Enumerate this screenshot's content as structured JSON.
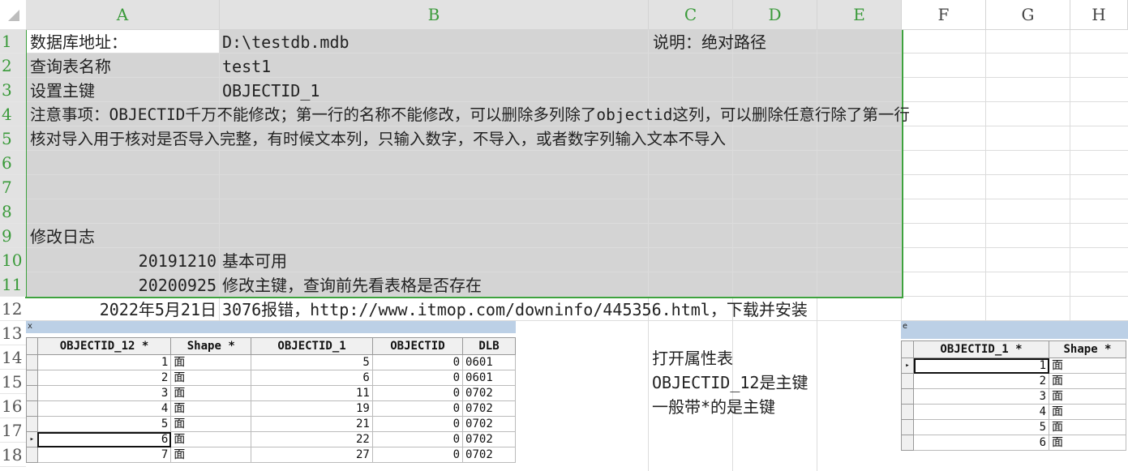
{
  "columns": [
    "A",
    "B",
    "C",
    "D",
    "E",
    "F",
    "G",
    "H"
  ],
  "rows": [
    "1",
    "2",
    "3",
    "4",
    "5",
    "6",
    "7",
    "8",
    "9",
    "10",
    "11",
    "12",
    "13",
    "14",
    "15",
    "16",
    "17",
    "18"
  ],
  "cells": {
    "a1": "数据库地址：",
    "b1": "D:\\testdb.mdb",
    "c1": "说明：绝对路径",
    "a2": "查询表名称",
    "b2": "test1",
    "a3": "设置主键",
    "b3": "OBJECTID_1",
    "a4": "注意事项：OBJECTID千万不能修改；第一行的名称不能修改，可以删除多列除了objectid这列，可以删除任意行除了第一行",
    "a5": "核对导入用于核对是否导入完整，有时候文本列，只输入数字，不导入，或者数字列输入文本不导入",
    "a9": "修改日志",
    "a10": "20191210",
    "b10": "基本可用",
    "a11": "20200925",
    "b11": "修改主键，查询前先看表格是否存在",
    "a12": "2022年5月21日",
    "b12": "3076报错，http://www.itmop.com/downinfo/445356.html，下载并安装"
  },
  "notes": [
    "打开属性表",
    "OBJECTID_12是主键",
    "一般带*的是主键"
  ],
  "table1": {
    "title": "x",
    "headers": [
      "OBJECTID_12 *",
      "Shape *",
      "OBJECTID_1",
      "OBJECTID",
      "DLB"
    ],
    "rows": [
      [
        "1",
        "面",
        "5",
        "0",
        "0601"
      ],
      [
        "2",
        "面",
        "6",
        "0",
        "0601"
      ],
      [
        "3",
        "面",
        "11",
        "0",
        "0702"
      ],
      [
        "4",
        "面",
        "19",
        "0",
        "0702"
      ],
      [
        "5",
        "面",
        "21",
        "0",
        "0702"
      ],
      [
        "6",
        "面",
        "22",
        "0",
        "0702"
      ],
      [
        "7",
        "面",
        "27",
        "0",
        "0702"
      ]
    ]
  },
  "table2": {
    "title": "e",
    "headers": [
      "OBJECTID_1 *",
      "Shape *"
    ],
    "rows": [
      [
        "1",
        "面"
      ],
      [
        "2",
        "面"
      ],
      [
        "3",
        "面"
      ],
      [
        "4",
        "面"
      ],
      [
        "5",
        "面"
      ],
      [
        "6",
        "面"
      ]
    ]
  }
}
